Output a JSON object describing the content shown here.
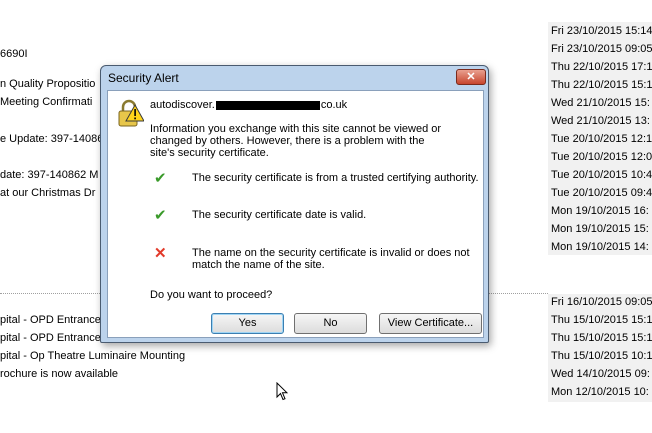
{
  "background_emails": {
    "subjects": [
      {
        "text": "6690I"
      },
      {
        "text": "n Quality Propositio"
      },
      {
        "text": "Meeting Confirmati"
      },
      {
        "text": "e Update: 397-14086"
      },
      {
        "text": "date: 397-140862 M"
      },
      {
        "text": "at our Christmas Dr"
      },
      {
        "text": "pital - OPD Entrance"
      },
      {
        "text": "pital - OPD Entrance"
      },
      {
        "text": "pital - Op Theatre Luminaire Mounting"
      },
      {
        "text": "rochure is now available"
      }
    ],
    "dates_group1": [
      "Fri 23/10/2015 15:14",
      "Fri 23/10/2015 09:05",
      "Thu 22/10/2015 17:1",
      "Thu 22/10/2015 15:1",
      "Wed 21/10/2015 15:",
      "Wed 21/10/2015 13:",
      "Tue 20/10/2015 12:1",
      "Tue 20/10/2015 12:0",
      "Tue 20/10/2015 10:4",
      "Tue 20/10/2015 09:4",
      "Mon 19/10/2015 16:",
      "Mon 19/10/2015 15:",
      "Mon 19/10/2015 14:"
    ],
    "dates_group2": [
      "Fri 16/10/2015 09:05",
      "Thu 15/10/2015 15:1",
      "Thu 15/10/2015 15:1",
      "Thu 15/10/2015 10:1",
      "Wed 14/10/2015 09:",
      "Mon 12/10/2015 10:"
    ]
  },
  "dialog": {
    "title": "Security Alert",
    "close_glyph": "✕",
    "host_prefix": "autodiscover.",
    "host_suffix": "co.uk",
    "info": "Information you exchange with this site cannot be viewed or changed by others. However, there is a problem with the site's security certificate.",
    "checks": [
      {
        "status": "ok",
        "glyph": "✔",
        "text": "The security certificate is from a trusted certifying authority."
      },
      {
        "status": "ok",
        "glyph": "✔",
        "text": "The security certificate date is valid."
      },
      {
        "status": "bad",
        "glyph": "✕",
        "text": "The name on the security certificate is invalid or does not match the name of the site."
      }
    ],
    "question": "Do you want to proceed?",
    "buttons": {
      "yes": "Yes",
      "no": "No",
      "view": "View Certificate..."
    }
  },
  "colors": {
    "ok": "#3a9a2a",
    "bad": "#e23a2a",
    "dialog_frame": "#bcd3ec"
  }
}
